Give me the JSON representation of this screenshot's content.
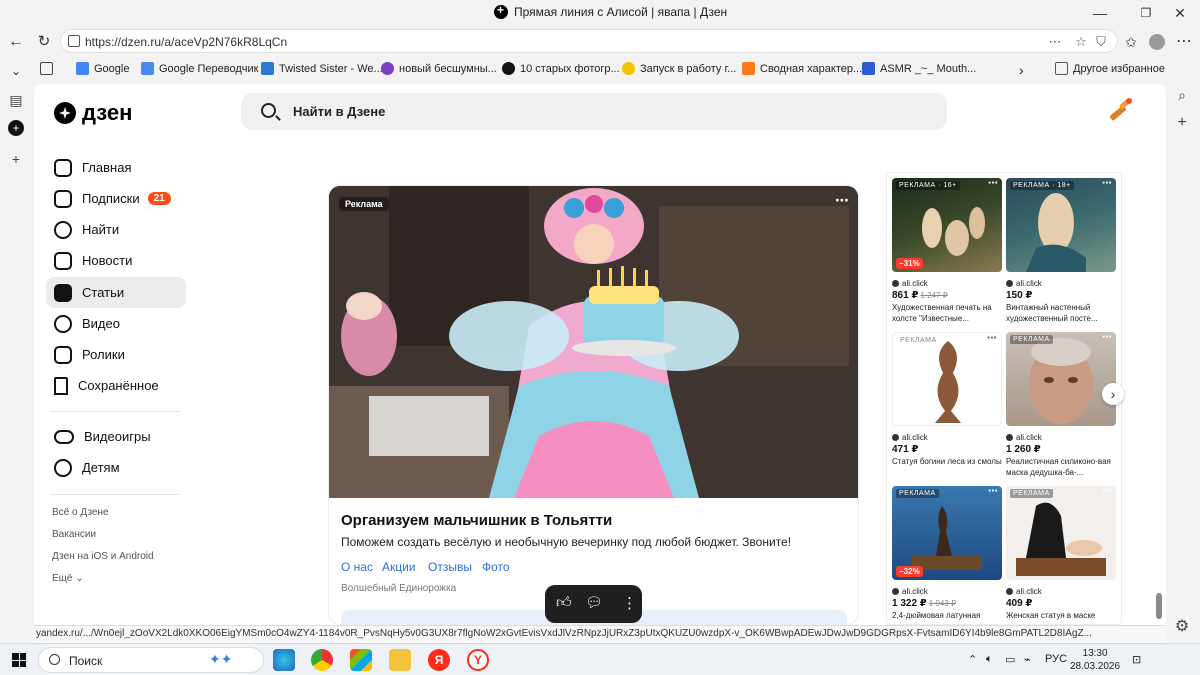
{
  "window": {
    "tab_title": "Прямая линия с Алисой | явапа | Дзен",
    "minimize": "—",
    "maximize": "❐",
    "close": "✕"
  },
  "address": {
    "url": "https://dzen.ru/a/aceVp2N76kR8LqCn"
  },
  "bookmarks": [
    {
      "label": "Google",
      "color": "#4285f4"
    },
    {
      "label": "Google Переводчик",
      "color": "#4a8af4"
    },
    {
      "label": "Twisted Sister - We...",
      "color": "#2b79d6"
    },
    {
      "label": "новый бесшумны...",
      "color": "#7b3fc4"
    },
    {
      "label": "10 старых фотогр...",
      "color": "#111111"
    },
    {
      "label": "Запуск в работу г...",
      "color": "#f5c400"
    },
    {
      "label": "Сводная характер...",
      "color": "#ff7a1a"
    },
    {
      "label": "ASMR _~_ Mouth...",
      "color": "#2e5bd1"
    },
    {
      "label": "Другое избранное",
      "color": "#666666"
    }
  ],
  "header": {
    "logo_text": "дзен",
    "search_placeholder": "Найти в Дзене"
  },
  "sidebar": {
    "items": [
      {
        "label": "Главная",
        "icon": "home-icon"
      },
      {
        "label": "Подписки",
        "icon": "subscriptions-icon",
        "badge": "21"
      },
      {
        "label": "Найти",
        "icon": "search-icon"
      },
      {
        "label": "Новости",
        "icon": "news-icon"
      },
      {
        "label": "Статьи",
        "icon": "articles-icon",
        "active": true
      },
      {
        "label": "Видео",
        "icon": "video-icon"
      },
      {
        "label": "Ролики",
        "icon": "shorts-icon"
      },
      {
        "label": "Сохранённое",
        "icon": "bookmark-icon"
      }
    ],
    "extra": [
      {
        "label": "Видеоигры",
        "icon": "gamepad-icon"
      },
      {
        "label": "Детям",
        "icon": "kids-icon"
      }
    ],
    "footer_links": [
      "Всё о Дзене",
      "Вакансии",
      "Дзен на iOS и Android",
      "Ещё"
    ]
  },
  "ad_card": {
    "label": "Реклама",
    "title": "Организуем мальчишник в Тольятти",
    "text": "Поможем создать весёлую и необычную вечеринку под любой бюджет. Звоните!",
    "links": [
      "О нас",
      "Акции",
      "Отзывы",
      "Фото"
    ],
    "source": "Волшебный Единорожка"
  },
  "ad_grid": {
    "tiles": [
      {
        "label": "РЕКЛАМА · 16+",
        "discount": "−31%",
        "seller": "ali.click",
        "price": "861 ₽",
        "old_price": "1 247 ₽",
        "desc": "Художественная печать на холсте \"Известные..."
      },
      {
        "label": "РЕКЛАМА · 18+",
        "discount": "",
        "seller": "ali.click",
        "price": "150 ₽",
        "old_price": "",
        "desc": "Винтажный настенный художественный посте..."
      },
      {
        "label": "РЕКЛАМА",
        "discount": "",
        "seller": "ali.click",
        "price": "471 ₽",
        "old_price": "",
        "desc": "Статуя богини леса из смолы"
      },
      {
        "label": "РЕКЛАМА",
        "discount": "",
        "seller": "ali.click",
        "price": "1 260 ₽",
        "old_price": "",
        "desc": "Реалистичная силиконо-вая маска дедушка-ба-..."
      },
      {
        "label": "РЕКЛАМА",
        "discount": "−32%",
        "seller": "ali.click",
        "price": "1 322 ₽",
        "old_price": "1 943 ₽",
        "desc": "2,4-дюймовая латунная"
      },
      {
        "label": "РЕКЛАМА",
        "discount": "",
        "seller": "ali.click",
        "price": "409 ₽",
        "old_price": "",
        "desc": "Женская статуя в маске"
      }
    ]
  },
  "status_url": "yandex.ru/.../Wn0ejl_zOoVX2Ldk0XKO06EigYMSm0cO4wZY4-1184v0R_PvsNqHy5v0G3UX8r7flgNoW2xGvtEvisVxdJlVzRNpzJjURxZ3pUtxQKUZU0wzdpX-v_OK6WBwpADEwJDwJwD9GDGRpsX-FvtsamID6YI4b9le8GmPATL2D8IAgZ...",
  "taskbar": {
    "search_label": "Поиск",
    "lang": "РУС",
    "time": "13:30",
    "date": "28.03.2026"
  }
}
